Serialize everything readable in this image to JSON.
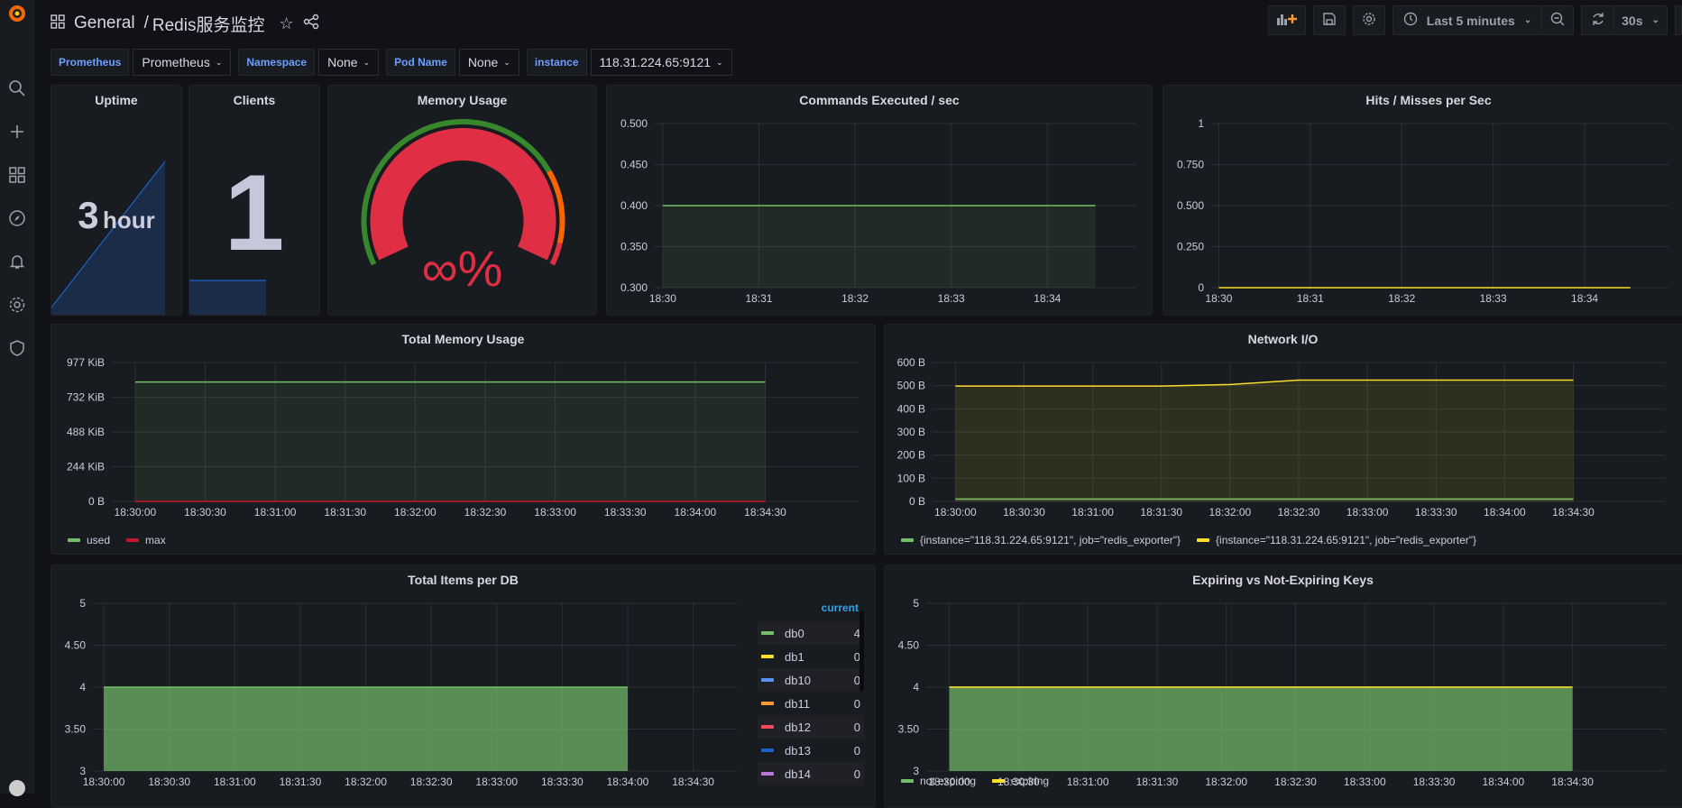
{
  "header": {
    "breadcrumb_folder": "General",
    "breadcrumb_sep": "/",
    "dashboard_title": "Redis服务监控",
    "time_range": "Last 5 minutes",
    "refresh_interval": "30s"
  },
  "sidebar": {
    "icons": [
      "grafana-logo",
      "search-icon",
      "plus-icon",
      "dashboards-icon",
      "explore-icon",
      "alerting-icon",
      "configuration-icon",
      "shield-icon"
    ]
  },
  "variables": [
    {
      "label": "Prometheus",
      "value": "Prometheus"
    },
    {
      "label": "Namespace",
      "value": "None"
    },
    {
      "label": "Pod Name",
      "value": "None"
    },
    {
      "label": "instance",
      "value": "118.31.224.65:9121"
    }
  ],
  "panels": {
    "uptime": {
      "title": "Uptime",
      "value": "3",
      "unit": "hour",
      "color": "#1f60c4"
    },
    "clients": {
      "title": "Clients",
      "value": "1",
      "color": "#1f60c4"
    },
    "memory_usage": {
      "title": "Memory Usage",
      "value": "∞%",
      "color": "#e02f44",
      "thresholds": [
        "#37872d",
        "#fa6400",
        "#e02f44"
      ]
    },
    "total_items_legend": {
      "header": "current",
      "items": [
        {
          "name": "db0",
          "value": "4",
          "color": "#73bf69"
        },
        {
          "name": "db1",
          "value": "0",
          "color": "#fade2a"
        },
        {
          "name": "db10",
          "value": "0",
          "color": "#5794f2"
        },
        {
          "name": "db11",
          "value": "0",
          "color": "#ff9830"
        },
        {
          "name": "db12",
          "value": "0",
          "color": "#f2495c"
        },
        {
          "name": "db13",
          "value": "0",
          "color": "#1f60c4"
        },
        {
          "name": "db14",
          "value": "0",
          "color": "#b877d9"
        }
      ]
    }
  },
  "chart_data": [
    {
      "id": "commands",
      "type": "line",
      "title": "Commands Executed / sec",
      "xlim": [
        "18:29:55",
        "18:34:55"
      ],
      "xticks": [
        "18:30",
        "18:31",
        "18:32",
        "18:33",
        "18:34"
      ],
      "ylim": [
        0.3,
        0.5
      ],
      "yticks": [
        {
          "v": 0.3,
          "l": "0.300"
        },
        {
          "v": 0.35,
          "l": "0.350"
        },
        {
          "v": 0.4,
          "l": "0.400"
        },
        {
          "v": 0.45,
          "l": "0.450"
        },
        {
          "v": 0.5,
          "l": "0.500"
        }
      ],
      "grid": true,
      "series": [
        {
          "color": "#73bf69",
          "fill": 0.1,
          "points": [
            [
              "18:30:00",
              0.4
            ],
            [
              "18:34:30",
              0.4
            ]
          ]
        }
      ]
    },
    {
      "id": "hits",
      "type": "line",
      "title": "Hits / Misses per Sec",
      "xlim": [
        "18:29:55",
        "18:34:55"
      ],
      "xticks": [
        "18:30",
        "18:31",
        "18:32",
        "18:33",
        "18:34"
      ],
      "ylim": [
        0,
        1
      ],
      "yticks": [
        {
          "v": 0,
          "l": "0"
        },
        {
          "v": 0.25,
          "l": "0.250"
        },
        {
          "v": 0.5,
          "l": "0.500"
        },
        {
          "v": 0.75,
          "l": "0.750"
        },
        {
          "v": 1,
          "l": "1"
        }
      ],
      "grid": true,
      "series": [
        {
          "color": "#fade2a",
          "fill": 0,
          "points": [
            [
              "18:30:00",
              0
            ],
            [
              "18:34:30",
              0
            ]
          ]
        }
      ]
    },
    {
      "id": "totalmem",
      "type": "line",
      "title": "Total Memory Usage",
      "xlim": [
        "18:29:50",
        "18:35:10"
      ],
      "xticks": [
        "18:30:00",
        "18:30:30",
        "18:31:00",
        "18:31:30",
        "18:32:00",
        "18:32:30",
        "18:33:00",
        "18:33:30",
        "18:34:00",
        "18:34:30"
      ],
      "ylim": [
        0,
        977
      ],
      "yticks": [
        {
          "v": 0,
          "l": "0 B"
        },
        {
          "v": 244,
          "l": "244 KiB"
        },
        {
          "v": 488,
          "l": "488 KiB"
        },
        {
          "v": 732,
          "l": "732 KiB"
        },
        {
          "v": 977,
          "l": "977 KiB"
        }
      ],
      "grid": true,
      "series": [
        {
          "name": "used",
          "color": "#73bf69",
          "fill": 0.1,
          "points": [
            [
              "18:30:00",
              840
            ],
            [
              "18:34:30",
              840
            ]
          ]
        },
        {
          "name": "max",
          "color": "#c4162a",
          "fill": 0,
          "points": [
            [
              "18:30:00",
              0
            ],
            [
              "18:34:30",
              0
            ]
          ]
        }
      ]
    },
    {
      "id": "network",
      "type": "line",
      "title": "Network I/O",
      "xlim": [
        "18:29:50",
        "18:35:10"
      ],
      "xticks": [
        "18:30:00",
        "18:30:30",
        "18:31:00",
        "18:31:30",
        "18:32:00",
        "18:32:30",
        "18:33:00",
        "18:33:30",
        "18:34:00",
        "18:34:30"
      ],
      "ylim": [
        0,
        600
      ],
      "yticks": [
        {
          "v": 0,
          "l": "0 B"
        },
        {
          "v": 100,
          "l": "100 B"
        },
        {
          "v": 200,
          "l": "200 B"
        },
        {
          "v": 300,
          "l": "300 B"
        },
        {
          "v": 400,
          "l": "400 B"
        },
        {
          "v": 500,
          "l": "500 B"
        },
        {
          "v": 600,
          "l": "600 B"
        }
      ],
      "grid": true,
      "series": [
        {
          "name": "{instance=\"118.31.224.65:9121\", job=\"redis_exporter\"}",
          "color": "#73bf69",
          "fill": 0.1,
          "points": [
            [
              "18:30:00",
              10
            ],
            [
              "18:34:30",
              10
            ]
          ]
        },
        {
          "name": "{instance=\"118.31.224.65:9121\", job=\"redis_exporter\"}",
          "color": "#fade2a",
          "fill": 0.1,
          "points": [
            [
              "18:30:00",
              498
            ],
            [
              "18:31:30",
              498
            ],
            [
              "18:32:00",
              505
            ],
            [
              "18:32:30",
              524
            ],
            [
              "18:34:30",
              524
            ]
          ]
        }
      ]
    },
    {
      "id": "items",
      "type": "area",
      "title": "Total Items per DB",
      "xlim": [
        "18:29:55",
        "18:34:50"
      ],
      "xticks": [
        "18:30:00",
        "18:30:30",
        "18:31:00",
        "18:31:30",
        "18:32:00",
        "18:32:30",
        "18:33:00",
        "18:33:30",
        "18:34:00",
        "18:34:30"
      ],
      "ylim": [
        3,
        5
      ],
      "yticks": [
        {
          "v": 3,
          "l": "3"
        },
        {
          "v": 3.5,
          "l": "3.50"
        },
        {
          "v": 4,
          "l": "4"
        },
        {
          "v": 4.5,
          "l": "4.50"
        },
        {
          "v": 5,
          "l": "5"
        }
      ],
      "grid": true,
      "series": [
        {
          "name": "db0",
          "color": "#73bf69",
          "fill": 0.7,
          "points": [
            [
              "18:30:00",
              4
            ],
            [
              "18:34:00",
              4
            ]
          ]
        }
      ]
    },
    {
      "id": "expiring",
      "type": "area",
      "title": "Expiring vs Not-Expiring Keys",
      "xlim": [
        "18:29:50",
        "18:35:10"
      ],
      "xticks": [
        "18:30:00",
        "18:30:30",
        "18:31:00",
        "18:31:30",
        "18:32:00",
        "18:32:30",
        "18:33:00",
        "18:33:30",
        "18:34:00",
        "18:34:30"
      ],
      "ylim": [
        3,
        5
      ],
      "yticks": [
        {
          "v": 3,
          "l": "3"
        },
        {
          "v": 3.5,
          "l": "3.50"
        },
        {
          "v": 4,
          "l": "4"
        },
        {
          "v": 4.5,
          "l": "4.50"
        },
        {
          "v": 5,
          "l": "5"
        }
      ],
      "grid": true,
      "series": [
        {
          "name": "not expiring",
          "color": "#73bf69",
          "fill": 0.7,
          "points": [
            [
              "18:30:00",
              4
            ],
            [
              "18:34:30",
              4
            ]
          ]
        },
        {
          "name": "expiring",
          "color": "#fade2a",
          "fill": 0,
          "points": [
            [
              "18:30:00",
              4
            ],
            [
              "18:34:30",
              4
            ]
          ]
        }
      ]
    }
  ]
}
